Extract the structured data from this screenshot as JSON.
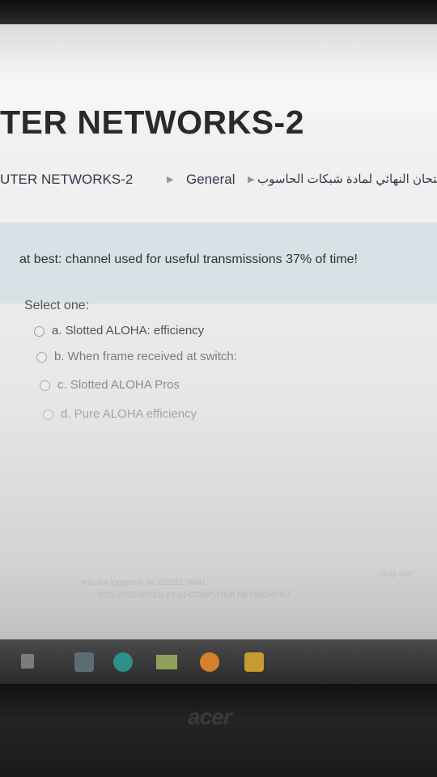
{
  "course": {
    "title": "TER NETWORKS-2"
  },
  "breadcrumb": {
    "course": "UTER NETWORKS-2",
    "separator": "▶",
    "general": "General",
    "quiz_arabic": "متحان النهائي لمادة شبكات الحاسوب"
  },
  "question": {
    "text": "at best: channel used for useful transmissions 37% of time!",
    "prompt": "Select one:",
    "options": [
      {
        "label": "a. Slotted ALOHA: efficiency",
        "selected": false
      },
      {
        "label": "b. When frame received at switch:",
        "selected": false
      },
      {
        "label": "c. Slotted ALOHA Pros",
        "selected": false
      },
      {
        "label": "d. Pure ALOHA efficiency",
        "selected": false
      }
    ]
  },
  "footer": {
    "logged_in": "You are logged in as 21815179091",
    "logout": "(Log out)",
    "course_line": "2021-2022-\\20\\21\\ 22-14-COMPUTER NETWORKS-2"
  },
  "taskbar": {
    "icons": [
      "windows-start-icon",
      "file-explorer-icon",
      "edge-browser-icon",
      "photos-icon",
      "chrome-icon",
      "store-icon"
    ]
  },
  "device": {
    "brand": "acer"
  },
  "colors": {
    "question_bg": "#d7e1e6",
    "link": "#2f3b4a"
  }
}
